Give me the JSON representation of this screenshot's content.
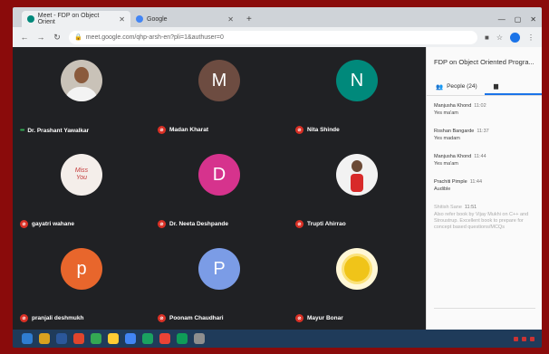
{
  "browser": {
    "tabs": [
      {
        "label": "Meet - FDP on Object Orient",
        "active": true,
        "color": "#00897b"
      },
      {
        "label": "Google",
        "active": false,
        "color": "#4285f4"
      }
    ],
    "url": "meet.google.com/qhp-arsh-en?pli=1&authuser=0"
  },
  "meeting": {
    "title": "FDP on Object Oriented Progra...",
    "people_label": "People (24)",
    "participants": [
      {
        "name": "Dr. Prashant Yawalkar",
        "kind": "photo",
        "letter": "",
        "color": "#c9c2b8",
        "speaking": true
      },
      {
        "name": "Madan Kharat",
        "kind": "letter",
        "letter": "M",
        "color": "#6d4c41",
        "speaking": false
      },
      {
        "name": "Nita Shinde",
        "kind": "letter",
        "letter": "N",
        "color": "#00897b",
        "speaking": false
      },
      {
        "name": "gayatri wahane",
        "kind": "card",
        "letter": "",
        "card_text": [
          "Miss",
          "You"
        ],
        "color": "#f4eeea",
        "speaking": false
      },
      {
        "name": "Dr. Neeta Deshpande",
        "kind": "letter",
        "letter": "D",
        "color": "#d6338d",
        "speaking": false
      },
      {
        "name": "Trupti Ahirrao",
        "kind": "child",
        "letter": "",
        "color": "#f2f2f2",
        "speaking": false
      },
      {
        "name": "pranjali deshmukh",
        "kind": "letter",
        "letter": "p",
        "color": "#e8662c",
        "speaking": false
      },
      {
        "name": "Poonam Chaudhari",
        "kind": "letter",
        "letter": "P",
        "color": "#7b9ce6",
        "speaking": false
      },
      {
        "name": "Mayur Bonar",
        "kind": "logo",
        "letter": "",
        "color": "#fff7d6",
        "speaking": false
      }
    ]
  },
  "chat": {
    "messages": [
      {
        "sender": "Manjusha Khond",
        "time": "11:02",
        "text": "Yes ma'am",
        "faded": false
      },
      {
        "sender": "Roshan Bangarde",
        "time": "11:37",
        "text": "Yes madam",
        "faded": false
      },
      {
        "sender": "Manjusha Khond",
        "time": "11:44",
        "text": "Yes ma'am",
        "faded": false
      },
      {
        "sender": "Prachiti Pimple",
        "time": "11:44",
        "text": "Audible",
        "faded": false
      },
      {
        "sender": "Shitish Sane",
        "time": "11:51",
        "text": "Also refer book by Vijay Mukhi on C++ and Stroustrup. Excellent book to prepare for concept based questions/MCQs",
        "faded": true
      }
    ]
  }
}
